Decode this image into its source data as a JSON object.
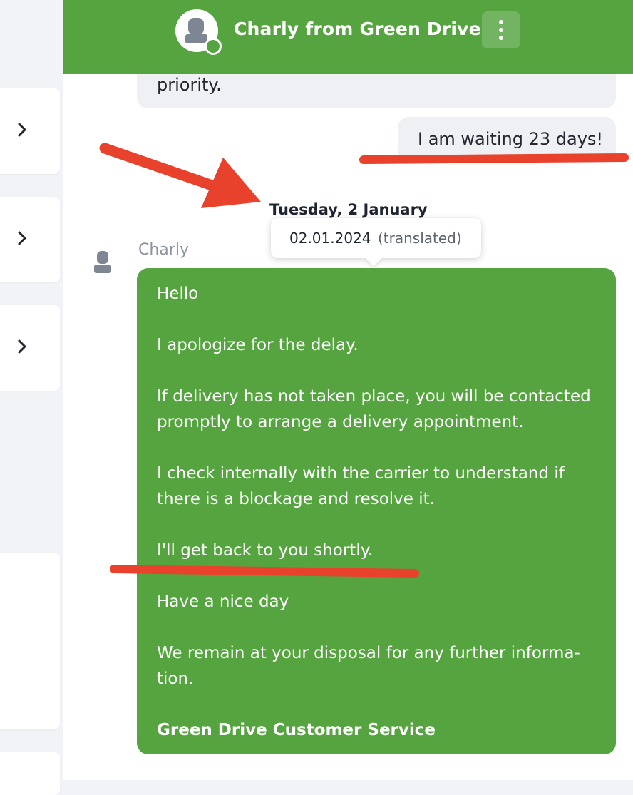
{
  "header": {
    "title": "Charly from Green Drive",
    "avatar_icon": "user-silhouette-icon",
    "menu_icon": "more-vertical-icon",
    "online": true,
    "color": "#55a440"
  },
  "sidebar": {
    "items": [
      {
        "icon": "chevron-right-icon"
      },
      {
        "icon": "chevron-right-icon"
      },
      {
        "icon": "chevron-right-icon"
      }
    ]
  },
  "messages": {
    "previous_incoming_tail": "priority.",
    "outgoing": "I am waiting 23 days!",
    "date_separator": "Tuesday, 2 January",
    "tooltip": {
      "date": "02.01.2024",
      "note": "(translated)"
    },
    "sender": "Charly",
    "reply": {
      "lines": [
        "Hello",
        "I apologize for the delay.",
        "If delivery has not taken place, you will be contacted promptly to arrange a delivery appointment.",
        "I check internally with the carrier to understand if there is a blockage and resolve it.",
        "I'll get back to you shortly.",
        "Have a nice day",
        "We remain at your disposal for any further informa-tion."
      ],
      "signature": "Green Drive Customer Service"
    }
  },
  "annotations": {
    "color": "#e8412c",
    "arrow_icon": "red-arrow-icon"
  }
}
